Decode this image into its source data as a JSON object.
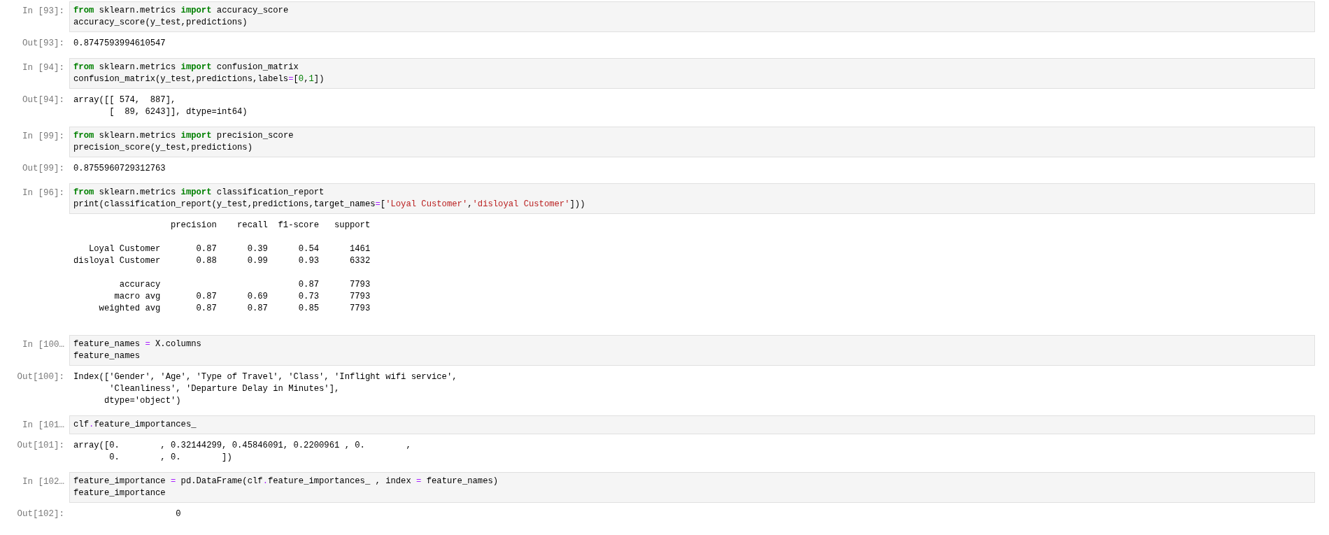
{
  "cells": [
    {
      "in_prompt": "In [93]:",
      "code": [
        [
          {
            "kind": "keyword",
            "text": "from"
          },
          {
            "kind": "plain",
            "text": " sklearn.metrics "
          },
          {
            "kind": "keyword",
            "text": "import"
          },
          {
            "kind": "plain",
            "text": " accuracy_score"
          }
        ],
        [
          {
            "kind": "plain",
            "text": "accuracy_score(y_test,predictions)"
          }
        ]
      ],
      "out_prompt": "Out[93]:",
      "output": "0.8747593994610547"
    },
    {
      "in_prompt": "In [94]:",
      "code": [
        [
          {
            "kind": "keyword",
            "text": "from"
          },
          {
            "kind": "plain",
            "text": " sklearn.metrics "
          },
          {
            "kind": "keyword",
            "text": "import"
          },
          {
            "kind": "plain",
            "text": " confusion_matrix"
          }
        ],
        [
          {
            "kind": "plain",
            "text": "confusion_matrix(y_test,predictions,labels"
          },
          {
            "kind": "operator",
            "text": "="
          },
          {
            "kind": "plain",
            "text": "["
          },
          {
            "kind": "number",
            "text": "0"
          },
          {
            "kind": "plain",
            "text": ","
          },
          {
            "kind": "number",
            "text": "1"
          },
          {
            "kind": "plain",
            "text": "])"
          }
        ]
      ],
      "out_prompt": "Out[94]:",
      "output": "array([[ 574,  887],\n       [  89, 6243]], dtype=int64)"
    },
    {
      "in_prompt": "In [99]:",
      "code": [
        [
          {
            "kind": "keyword",
            "text": "from"
          },
          {
            "kind": "plain",
            "text": " sklearn.metrics "
          },
          {
            "kind": "keyword",
            "text": "import"
          },
          {
            "kind": "plain",
            "text": " precision_score"
          }
        ],
        [
          {
            "kind": "plain",
            "text": "precision_score(y_test,predictions)"
          }
        ]
      ],
      "out_prompt": "Out[99]:",
      "output": "0.8755960729312763"
    },
    {
      "in_prompt": "In [96]:",
      "code": [
        [
          {
            "kind": "keyword",
            "text": "from"
          },
          {
            "kind": "plain",
            "text": " sklearn.metrics "
          },
          {
            "kind": "keyword",
            "text": "import"
          },
          {
            "kind": "plain",
            "text": " classification_report"
          }
        ],
        [
          {
            "kind": "plain",
            "text": "print(classification_report(y_test,predictions,target_names"
          },
          {
            "kind": "operator",
            "text": "="
          },
          {
            "kind": "plain",
            "text": "["
          },
          {
            "kind": "string",
            "text": "'Loyal Customer'"
          },
          {
            "kind": "plain",
            "text": ","
          },
          {
            "kind": "string",
            "text": "'disloyal Customer'"
          },
          {
            "kind": "plain",
            "text": "]))"
          }
        ]
      ],
      "output": "                   precision    recall  f1-score   support\n\n   Loyal Customer       0.87      0.39      0.54      1461\ndisloyal Customer       0.88      0.99      0.93      6332\n\n         accuracy                           0.87      7793\n        macro avg       0.87      0.69      0.73      7793\n     weighted avg       0.87      0.87      0.85      7793\n "
    },
    {
      "in_prompt": "In [100…",
      "code": [
        [
          {
            "kind": "plain",
            "text": "feature_names "
          },
          {
            "kind": "operator",
            "text": "="
          },
          {
            "kind": "plain",
            "text": " X.columns"
          }
        ],
        [
          {
            "kind": "plain",
            "text": "feature_names"
          }
        ]
      ],
      "out_prompt": "Out[100]:",
      "output": "Index(['Gender', 'Age', 'Type of Travel', 'Class', 'Inflight wifi service',\n       'Cleanliness', 'Departure Delay in Minutes'],\n      dtype='object')"
    },
    {
      "in_prompt": "In [101…",
      "code": [
        [
          {
            "kind": "plain",
            "text": "clf"
          },
          {
            "kind": "operator",
            "text": "."
          },
          {
            "kind": "plain",
            "text": "feature_importances_"
          }
        ]
      ],
      "out_prompt": "Out[101]:",
      "output": "array([0.        , 0.32144299, 0.45846091, 0.2200961 , 0.        ,\n       0.        , 0.        ])"
    },
    {
      "in_prompt": "In [102…",
      "code": [
        [
          {
            "kind": "plain",
            "text": "feature_importance "
          },
          {
            "kind": "operator",
            "text": "="
          },
          {
            "kind": "plain",
            "text": " pd.DataFrame(clf"
          },
          {
            "kind": "operator",
            "text": "."
          },
          {
            "kind": "plain",
            "text": "feature_importances_ , index "
          },
          {
            "kind": "operator",
            "text": "="
          },
          {
            "kind": "plain",
            "text": " feature_names)"
          }
        ],
        [
          {
            "kind": "plain",
            "text": "feature_importance"
          }
        ]
      ],
      "out_prompt": "Out[102]:",
      "output": "                    0"
    }
  ]
}
